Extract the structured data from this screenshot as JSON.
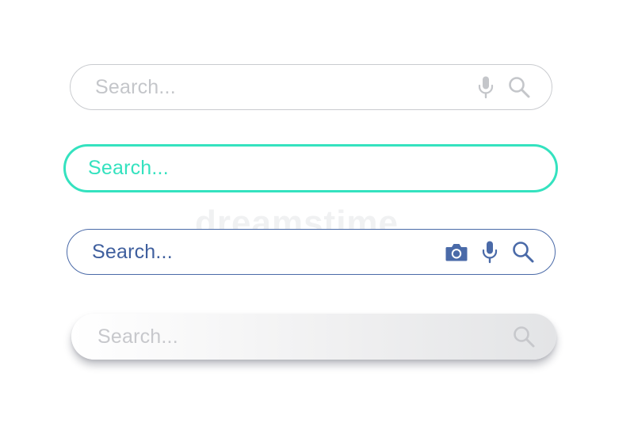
{
  "watermark": "dreamstime",
  "search_bars": [
    {
      "id": "light-outline",
      "placeholder": "Search...",
      "icons": [
        "microphone-icon",
        "search-icon"
      ],
      "accent": "#c4c6ca"
    },
    {
      "id": "teal-focused",
      "placeholder": "Search...",
      "icons": [],
      "accent": "#34e2bf"
    },
    {
      "id": "blue-outline",
      "placeholder": "Search...",
      "icons": [
        "camera-icon",
        "microphone-icon",
        "search-icon"
      ],
      "accent": "#3f5f9e"
    },
    {
      "id": "raised-gradient",
      "placeholder": "Search...",
      "icons": [
        "search-icon"
      ],
      "accent": "#c7c8cc"
    }
  ]
}
